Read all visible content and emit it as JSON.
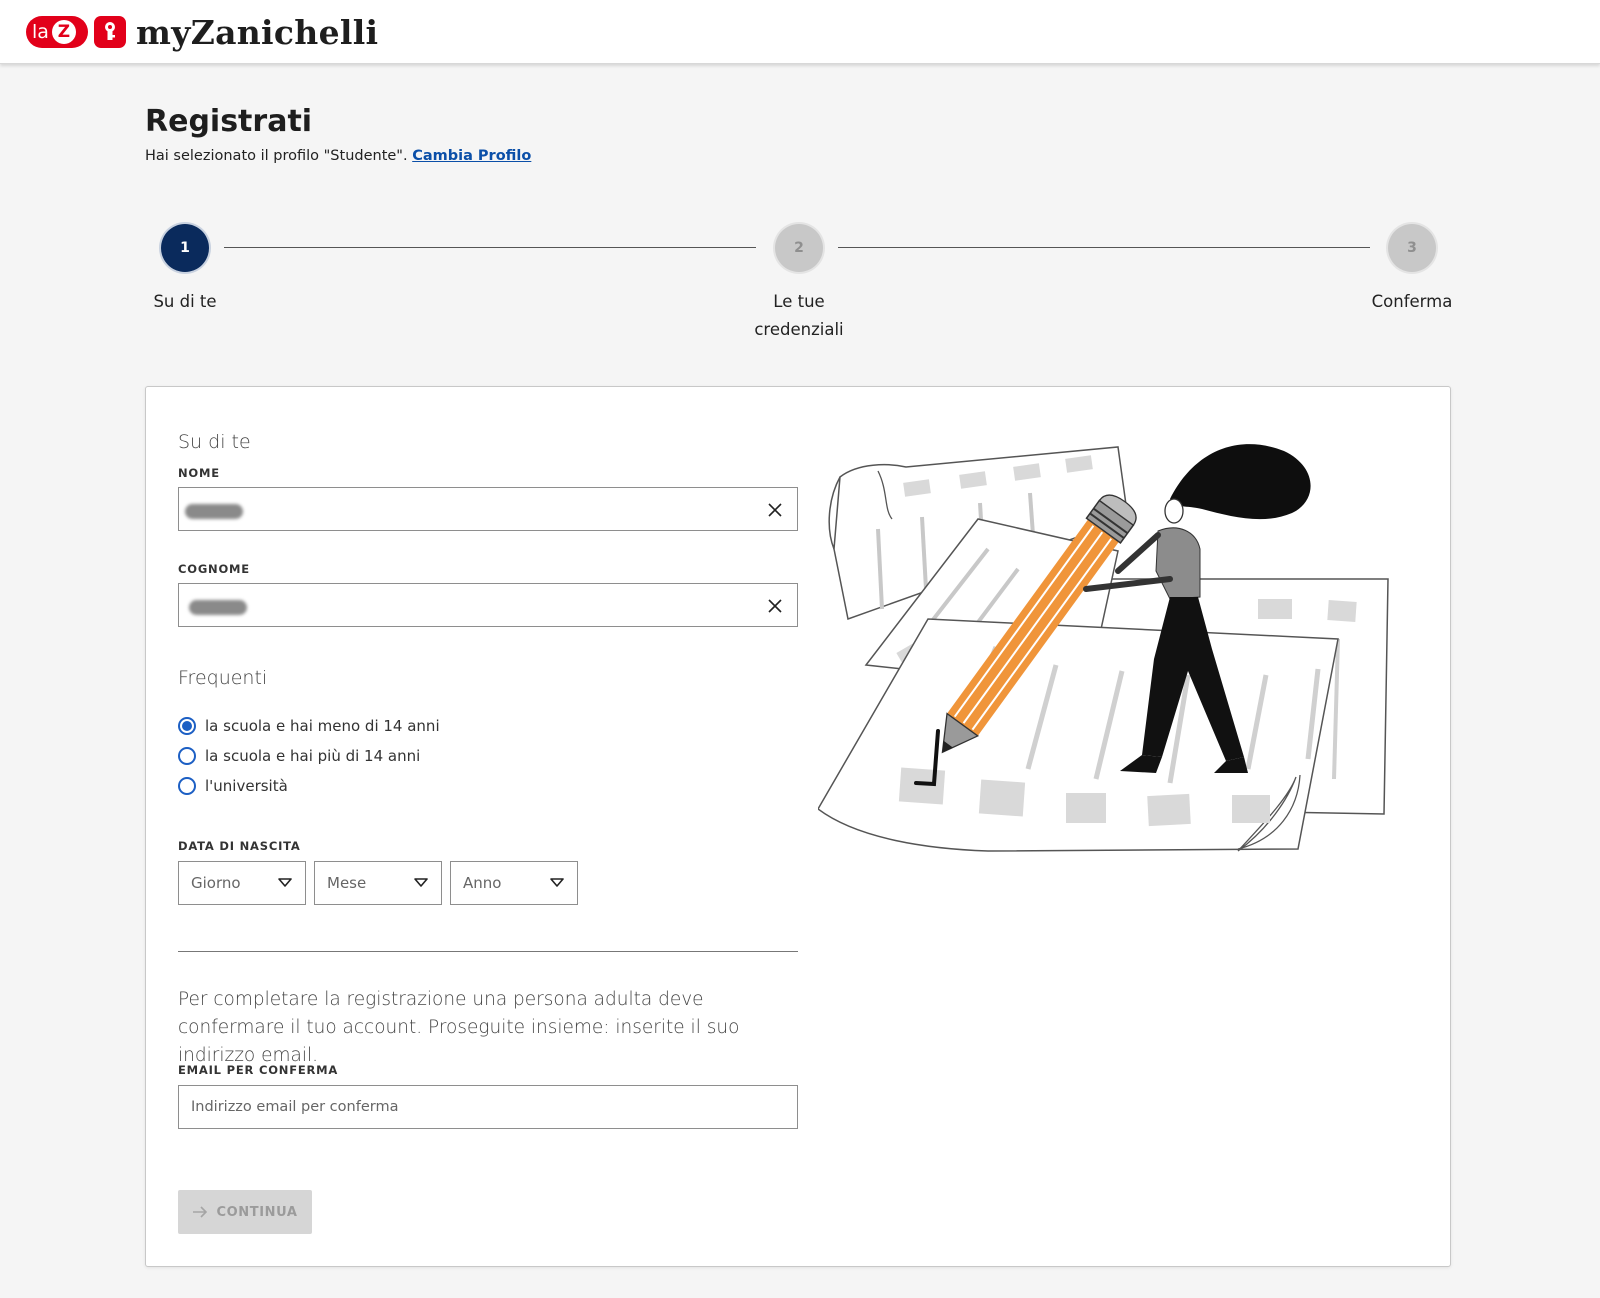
{
  "header": {
    "logo_laz_text": "la",
    "logo_z_letter": "Z",
    "logo_brand": "myZanichelli"
  },
  "page": {
    "title": "Registrati",
    "subtitle_text": "Hai selezionato il profilo \"Studente\". ",
    "change_profile_link": "Cambia Profilo"
  },
  "stepper": {
    "steps": [
      {
        "number": "1",
        "label": "Su di te",
        "state": "active"
      },
      {
        "number": "2",
        "label_line1": "Le tue",
        "label_line2": "credenziali",
        "state": "inactive"
      },
      {
        "number": "3",
        "label": "Conferma",
        "state": "inactive"
      }
    ]
  },
  "form": {
    "section_title": "Su di te",
    "nome_label": "NOME",
    "cognome_label": "COGNOME",
    "frequenti_title": "Frequenti",
    "radio_options": [
      {
        "label": "la scuola e hai meno di 14 anni",
        "checked": true
      },
      {
        "label": "la scuola e hai più di 14 anni",
        "checked": false
      },
      {
        "label": "l'università",
        "checked": false
      }
    ],
    "birth_label": "DATA DI NASCITA",
    "birth_day_placeholder": "Giorno",
    "birth_month_placeholder": "Mese",
    "birth_year_placeholder": "Anno",
    "notice": "Per completare la registrazione una persona adulta deve confermare il tuo account. Proseguite insieme: inserite il suo indirizzo email.",
    "email_label": "EMAIL PER CONFERMA",
    "email_placeholder": "Indirizzo email per conferma",
    "continue_label": "CONTINUA"
  },
  "colors": {
    "brand_red": "#e2001a",
    "step_active": "#0a2a5c",
    "link_blue": "#0b4fa8",
    "radio_blue": "#1c5fc4",
    "pencil_orange": "#f0953a"
  }
}
